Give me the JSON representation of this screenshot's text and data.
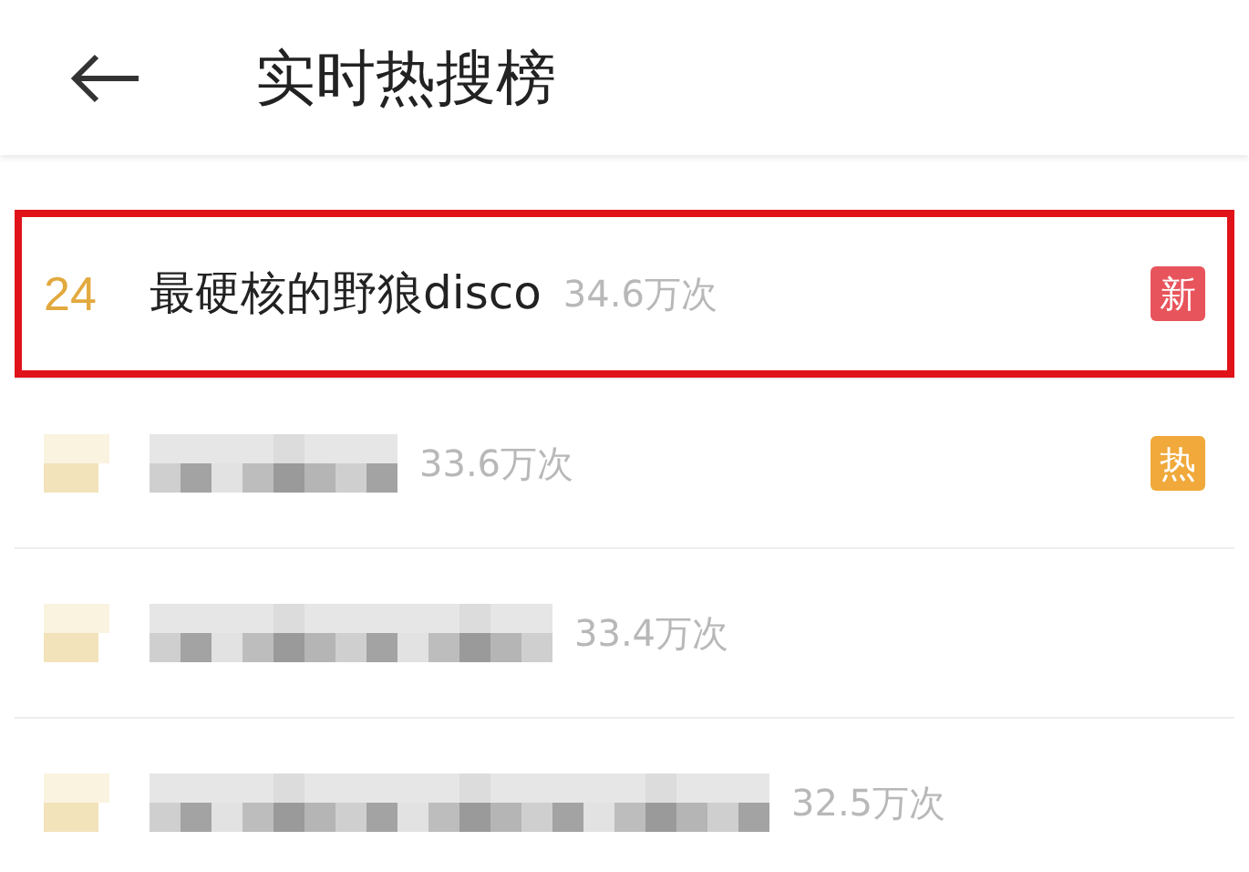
{
  "header": {
    "title": "实时热搜榜"
  },
  "rows": [
    {
      "kind": "plain",
      "rank": "24",
      "title": "最硬核的野狼disco",
      "count": "34.6万次",
      "highlighted": true,
      "badge": {
        "text": "新",
        "kind": "new"
      }
    },
    {
      "kind": "blurred",
      "count": "33.6万次",
      "highlighted": false,
      "badge": {
        "text": "热",
        "kind": "hot"
      }
    },
    {
      "kind": "blurred",
      "count": "33.4万次",
      "highlighted": false
    },
    {
      "kind": "blurred",
      "count": "32.5万次",
      "highlighted": false
    }
  ]
}
